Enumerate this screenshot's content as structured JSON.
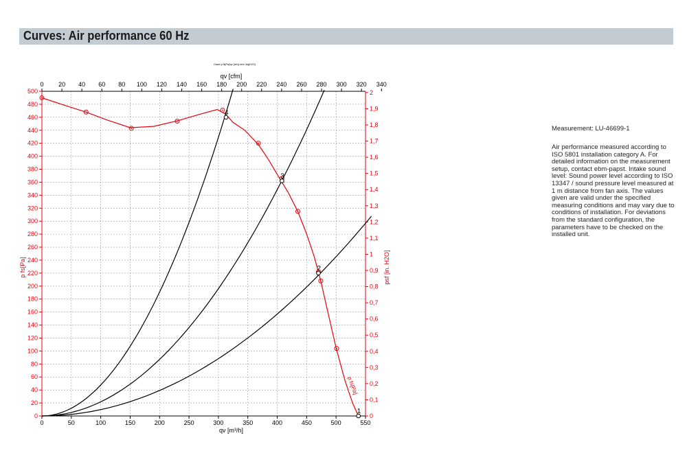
{
  "header": {
    "title": "Curves: Air performance 60 Hz"
  },
  "side": {
    "measurement": "Measurement: LU-46699-1",
    "description": "Air performance measured according to ISO 5801 installation category A. For detailed information on the measurement setup, contact ebm-papst. Intake sound level: Sound power level according to ISO 13347 / sound pressure level measured at 1 m distance from fan axis. The values given are valid under the specified measuring conditions and may vary due to conditions of installation. For deviations from the standard configuration, the parameters have to be checked on the installed unit."
  },
  "colors": {
    "fan_curve": "#e8000b",
    "system_curve": "#000000",
    "grid": "#9a9a9a",
    "header_bg": "#c3ccd3"
  },
  "chart_data": {
    "type": "line",
    "title": "",
    "tiny_caption": "Daalo p fs[Pa]/qv [cfm]/ and ,fsq[H2O]",
    "x_bottom": {
      "label": "qv [m³/h]",
      "range": [
        0,
        550
      ],
      "ticks": [
        0,
        50,
        100,
        150,
        200,
        250,
        300,
        350,
        400,
        450,
        500,
        550
      ]
    },
    "x_top": {
      "label": "qv [cfm]",
      "range": [
        0,
        324
      ],
      "ticks": [
        0,
        20,
        40,
        60,
        80,
        100,
        120,
        140,
        160,
        180,
        200,
        220,
        240,
        260,
        280,
        300,
        320,
        340
      ]
    },
    "y_left": {
      "label": "p fs[Pa]",
      "range": [
        0,
        500
      ],
      "ticks": [
        0,
        20,
        40,
        60,
        80,
        100,
        120,
        140,
        160,
        180,
        200,
        220,
        240,
        260,
        280,
        300,
        320,
        340,
        360,
        380,
        400,
        420,
        440,
        460,
        480,
        500
      ]
    },
    "y_right": {
      "label": "psf [in. H2O]",
      "range": [
        0,
        2.008
      ],
      "ticks": [
        "0",
        "0,1",
        "0,2",
        "0,3",
        "0,4",
        "0,5",
        "0,6",
        "0,7",
        "0,8",
        "0,9",
        "1",
        "1,1",
        "1,2",
        "1,3",
        "1,4",
        "1,5",
        "1,6",
        "1,7",
        "1,8",
        "1,9",
        "2"
      ]
    },
    "grid": true,
    "series": [
      {
        "name": "p fs[Pa]",
        "kind": "fan_curve",
        "points": [
          [
            0,
            490
          ],
          [
            40,
            478
          ],
          [
            75,
            468
          ],
          [
            110,
            456
          ],
          [
            150,
            444
          ],
          [
            190,
            446
          ],
          [
            232,
            455
          ],
          [
            270,
            465
          ],
          [
            298,
            472
          ],
          [
            312,
            465
          ],
          [
            325,
            452
          ],
          [
            345,
            440
          ],
          [
            368,
            418
          ],
          [
            385,
            395
          ],
          [
            400,
            372
          ],
          [
            418,
            345
          ],
          [
            435,
            315
          ],
          [
            450,
            280
          ],
          [
            463,
            245
          ],
          [
            474,
            208
          ],
          [
            486,
            160
          ],
          [
            500,
            105
          ],
          [
            515,
            55
          ],
          [
            528,
            20
          ],
          [
            538,
            0
          ]
        ],
        "markers": [
          [
            0,
            490
          ],
          [
            75,
            468
          ],
          [
            152,
            443
          ],
          [
            230,
            454
          ],
          [
            307,
            471
          ],
          [
            368,
            420
          ],
          [
            408,
            366
          ],
          [
            435,
            315
          ],
          [
            470,
            222
          ],
          [
            474,
            208
          ],
          [
            501,
            104
          ]
        ]
      },
      {
        "name": "",
        "kind": "system_curve",
        "k": 0.004768,
        "x_end": 325
      },
      {
        "name": "",
        "kind": "system_curve",
        "k": 0.002178,
        "x_end": 480
      },
      {
        "name": "",
        "kind": "system_curve",
        "k": 0.000981,
        "x_end": 560
      }
    ],
    "operating_points": [
      {
        "label": "1",
        "x": 538,
        "y": 0
      },
      {
        "label": "2",
        "x": 470,
        "y": 220
      },
      {
        "label": "3",
        "x": 408,
        "y": 362
      },
      {
        "label": "4",
        "x": 313,
        "y": 460
      }
    ]
  }
}
